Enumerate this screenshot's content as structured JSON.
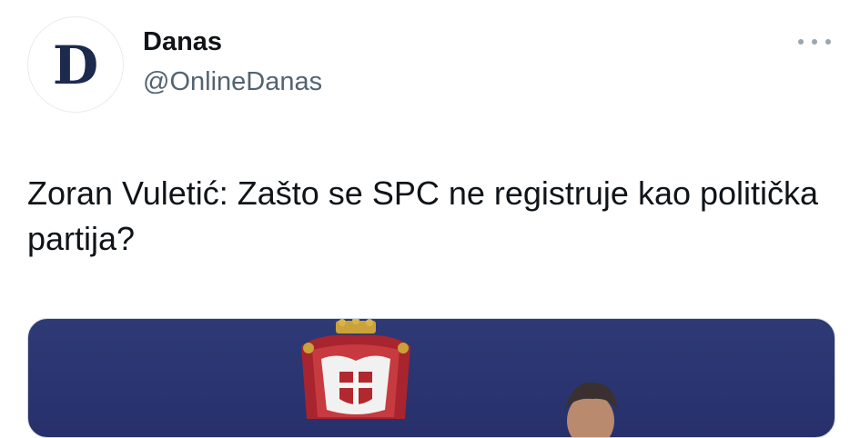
{
  "tweet": {
    "author": {
      "avatar_letter": "D",
      "display_name": "Danas",
      "handle": "@OnlineDanas"
    },
    "more_icon": "more-horizontal-icon",
    "text": "Zoran Vuletić: Zašto se SPC ne registruje kao politička partija?",
    "media": {
      "kind": "photo",
      "background_color": "#2e3a75"
    }
  },
  "colors": {
    "text_primary": "#0f1419",
    "text_secondary": "#536471",
    "avatar_letter": "#1c2a4e"
  }
}
